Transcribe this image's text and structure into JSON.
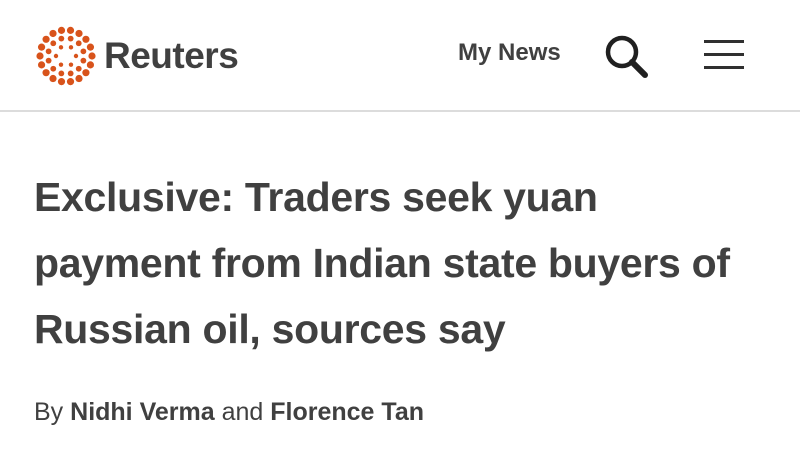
{
  "header": {
    "brand": "Reuters",
    "nav_label": "My News",
    "search_icon": "search-icon",
    "menu_icon": "hamburger-menu-icon",
    "brand_color": "#d8531b"
  },
  "article": {
    "headline": "Exclusive: Traders seek yuan payment from Indian state buyers of Russian oil, sources say",
    "byline": {
      "prefix": "By",
      "author_1": "Nidhi Verma",
      "conjunction": "and",
      "author_2": "Florence Tan"
    }
  }
}
